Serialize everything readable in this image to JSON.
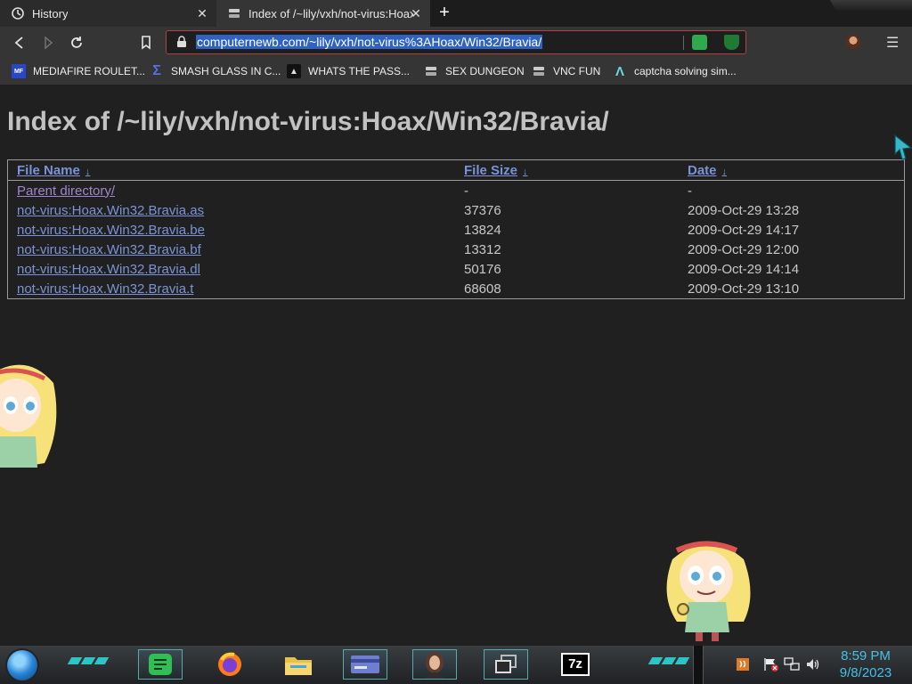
{
  "tabs": [
    {
      "label": "History",
      "icon": "history-icon",
      "active": false
    },
    {
      "label": "Index of /~lily/vxh/not-virus:Hoax/",
      "icon": "server-icon",
      "active": true
    }
  ],
  "toolbar": {
    "url": "computernewb.com/~lily/vxh/not-virus%3AHoax/Win32/Bravia/",
    "accent_color": "#b0413e"
  },
  "bookmarks": [
    {
      "label": "MEDIAFIRE ROULET...",
      "icon": "mediafire-icon"
    },
    {
      "label": "SMASH GLASS IN C...",
      "icon": "sigma-icon"
    },
    {
      "label": "WHATS THE PASS...",
      "icon": "bot-icon"
    },
    {
      "label": "SEX DUNGEON",
      "icon": "server-icon"
    },
    {
      "label": "VNC FUN",
      "icon": "server-icon"
    },
    {
      "label": "captcha solving sim...",
      "icon": "arrow-icon"
    }
  ],
  "page": {
    "title": "Index of /~lily/vxh/not-virus:Hoax/Win32/Bravia/",
    "columns": {
      "name": "File Name",
      "size": "File Size",
      "date": "Date",
      "sort_glyph": "↓"
    },
    "rows": [
      {
        "name": "Parent directory/",
        "size": "-",
        "date": "-"
      },
      {
        "name": "not-virus:Hoax.Win32.Bravia.as",
        "size": "37376",
        "date": "2009-Oct-29 13:28"
      },
      {
        "name": "not-virus:Hoax.Win32.Bravia.be",
        "size": "13824",
        "date": "2009-Oct-29 14:17"
      },
      {
        "name": "not-virus:Hoax.Win32.Bravia.bf",
        "size": "13312",
        "date": "2009-Oct-29 12:00"
      },
      {
        "name": "not-virus:Hoax.Win32.Bravia.dl",
        "size": "50176",
        "date": "2009-Oct-29 14:14"
      },
      {
        "name": "not-virus:Hoax.Win32.Bravia.t",
        "size": "68608",
        "date": "2009-Oct-29 13:10"
      }
    ],
    "link_color": "#7b93d6"
  },
  "taskbar": {
    "pinned": [
      "notes-app-icon",
      "firefox-icon",
      "file-explorer-icon",
      "card-app-icon",
      "portrait-app-icon",
      "window-switcher-icon",
      "7zip-icon"
    ],
    "sevenzip_label": "7z",
    "clock_time": "8:59 PM",
    "clock_date": "9/8/2023",
    "clock_color": "#45c0e8"
  }
}
